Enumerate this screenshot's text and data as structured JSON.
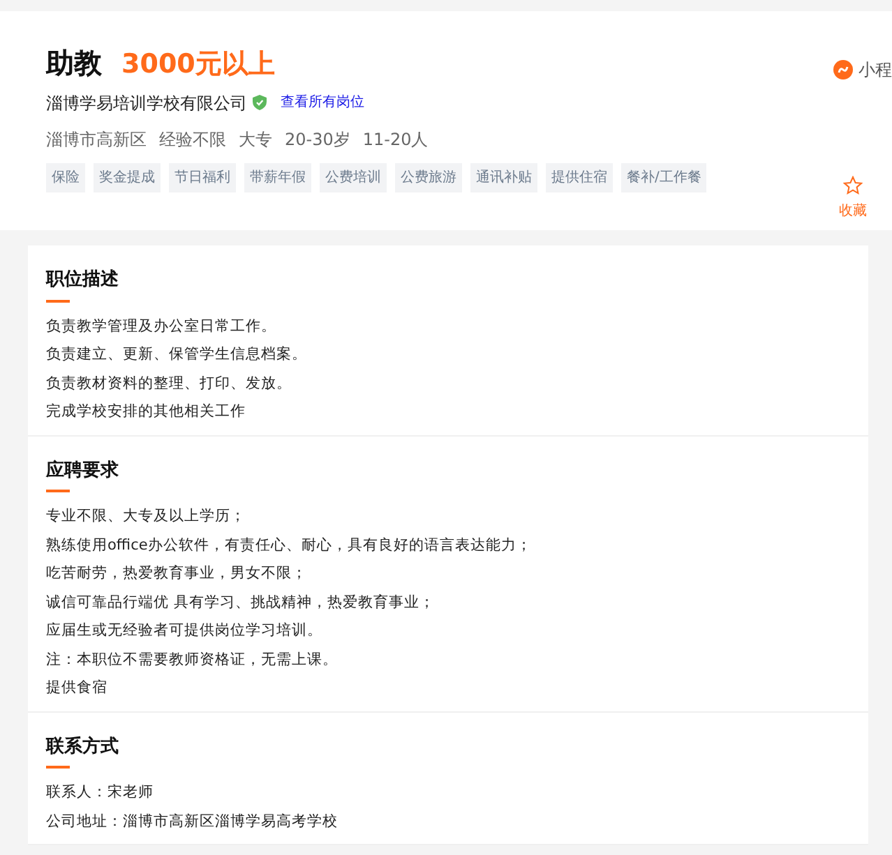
{
  "job": {
    "title": "助教",
    "salary": "3000元以上",
    "company": "淄博学易培训学校有限公司",
    "verified": true,
    "all_jobs_link": "查看所有岗位",
    "meta": [
      "淄博市高新区",
      "经验不限",
      "大专",
      "20-30岁",
      "11-20人"
    ],
    "tags": [
      "保险",
      "奖金提成",
      "节日福利",
      "带薪年假",
      "公费培训",
      "公费旅游",
      "通讯补贴",
      "提供住宿",
      "餐补/工作餐"
    ],
    "mini_program": "小程",
    "favorite": "收藏"
  },
  "sections": [
    {
      "title": "职位描述",
      "lines": [
        "负责教学管理及办公室日常工作。",
        "负责建立、更新、保管学生信息档案。",
        "负责教材资料的整理、打印、发放。",
        "完成学校安排的其他相关工作"
      ]
    },
    {
      "title": "应聘要求",
      "lines": [
        "专业不限、大专及以上学历；",
        "熟练使用office办公软件，有责任心、耐心，具有良好的语言表达能力；",
        "吃苦耐劳，热爱教育事业，男女不限；",
        "诚信可靠品行端优 具有学习、挑战精神，热爱教育事业；",
        "应届生或无经验者可提供岗位学习培训。",
        "注：本职位不需要教师资格证，无需上课。",
        "提供食宿"
      ]
    },
    {
      "title": "联系方式",
      "lines": [
        "联系人：宋老师",
        "公司地址：淄博市高新区淄博学易高考学校"
      ]
    }
  ]
}
